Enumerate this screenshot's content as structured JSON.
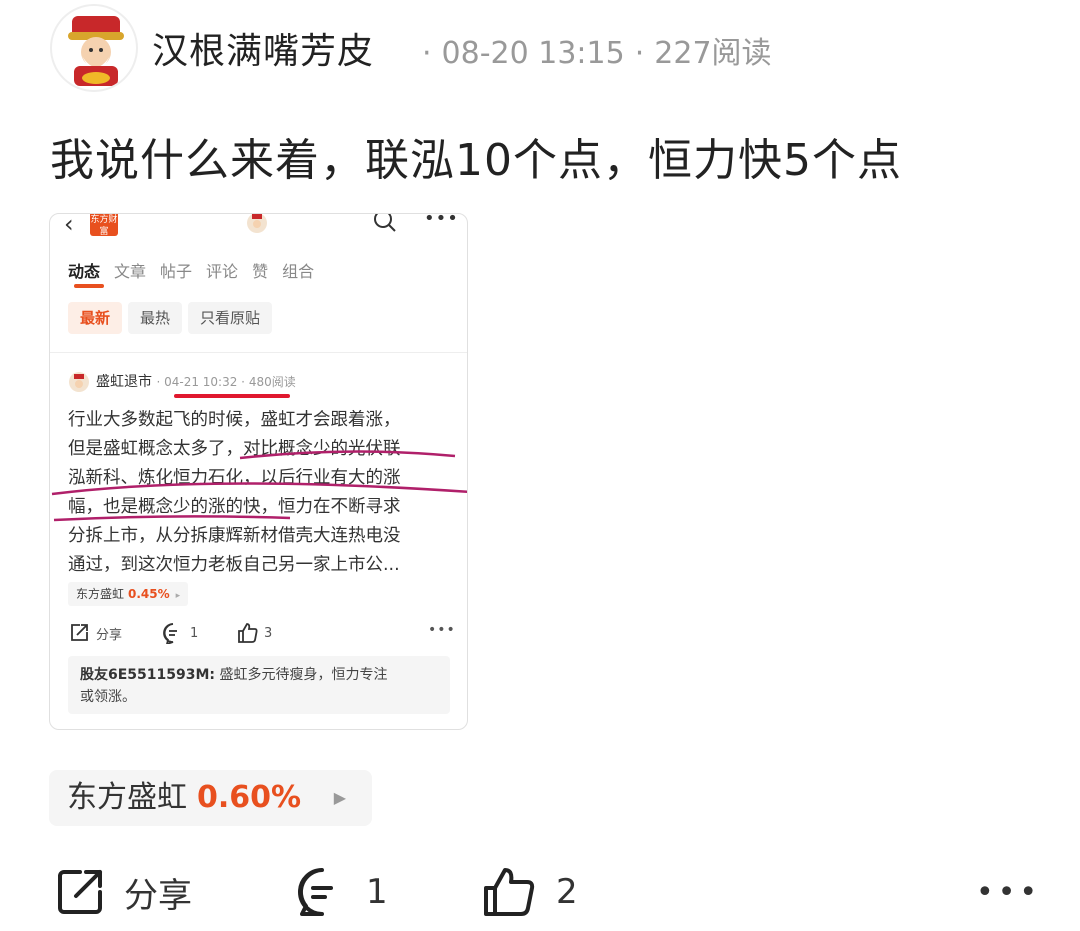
{
  "post": {
    "author": "汉根满嘴芳皮",
    "date": "08-20 13:15",
    "reads": "227阅读",
    "text": "我说什么来着，联泓10个点，恒力快5个点"
  },
  "embedded": {
    "brand": "东方财富",
    "tabs": [
      "动态",
      "文章",
      "帖子",
      "评论",
      "赞",
      "组合"
    ],
    "filters": [
      "最新",
      "最热",
      "只看原贴"
    ],
    "inner_post": {
      "author": "盛虹退市",
      "date": "04-21 10:32",
      "reads": "480阅读",
      "lines": [
        "行业大多数起飞的时候，盛虹才会跟着涨，",
        "但是盛虹概念太多了，对比概念少的光伏联",
        "泓新科、炼化恒力石化，以后行业有大的涨",
        "幅，也是概念少的涨的快，恒力在不断寻求",
        "分拆上市，从分拆康辉新材借壳大连热电没",
        "通过，到这次恒力老板自己另一家上市公..."
      ]
    },
    "stock": {
      "name": "东方盛虹",
      "change": "0.45%"
    },
    "actions": {
      "share": "分享",
      "comments": "1",
      "likes": "3"
    },
    "comment": {
      "user": "股友6E5511593M:",
      "text": "盛虹多元待瘦身，恒力专注",
      "text2": "或领涨。"
    }
  },
  "stock_tag": {
    "name": "东方盛虹",
    "change": "0.60%"
  },
  "actions": {
    "share": "分享",
    "comments": "1",
    "likes": "2"
  },
  "colors": {
    "accent": "#e8501f",
    "underline_red": "#e0182e",
    "scribble": "#b0206a"
  }
}
